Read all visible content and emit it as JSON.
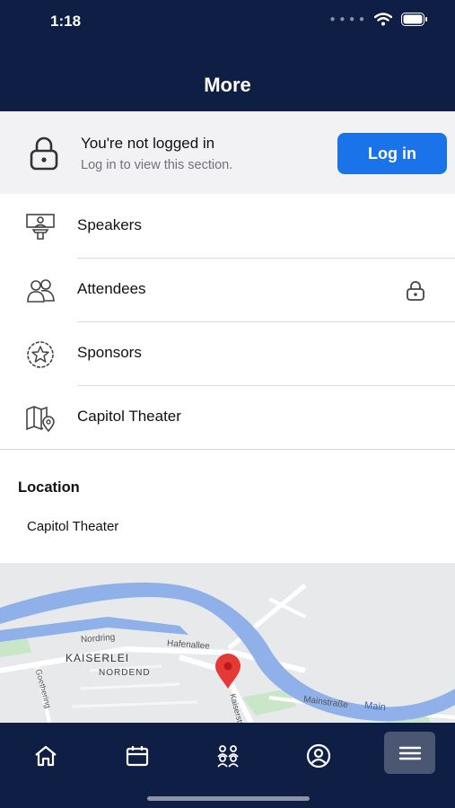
{
  "status_bar": {
    "time": "1:18"
  },
  "header": {
    "title": "More"
  },
  "login_banner": {
    "title": "You're not logged in",
    "subtitle": "Log in to view this section.",
    "button_label": "Log in"
  },
  "menu": {
    "items": [
      {
        "label": "Speakers",
        "icon": "speaker-podium-icon",
        "locked": false
      },
      {
        "label": "Attendees",
        "icon": "attendees-icon",
        "locked": true
      },
      {
        "label": "Sponsors",
        "icon": "sponsor-star-badge-icon",
        "locked": false
      },
      {
        "label": "Capitol Theater",
        "icon": "map-location-icon",
        "locked": false
      }
    ]
  },
  "location": {
    "heading": "Location",
    "name": "Capitol Theater",
    "map_labels": {
      "nordring": "Nordring",
      "hafenallee": "Hafenallee",
      "kaiserlei": "KAISERLEI",
      "nordend": "NORDEND",
      "goethering": "Goethering",
      "kaiserstr": "Kaiserstr",
      "mainstrasse": "Mainstraße",
      "main": "Main"
    }
  },
  "tab_bar": {
    "tabs": [
      {
        "icon": "home-icon",
        "active": false
      },
      {
        "icon": "calendar-icon",
        "active": false
      },
      {
        "icon": "people-icon",
        "active": false
      },
      {
        "icon": "profile-icon",
        "active": false
      },
      {
        "icon": "menu-icon",
        "active": true
      }
    ]
  },
  "colors": {
    "header_bg": "#0f1e45",
    "accent": "#1a73e8",
    "banner_bg": "#f2f2f4",
    "river": "#8fb0e8",
    "map_pin": "#e53935"
  }
}
